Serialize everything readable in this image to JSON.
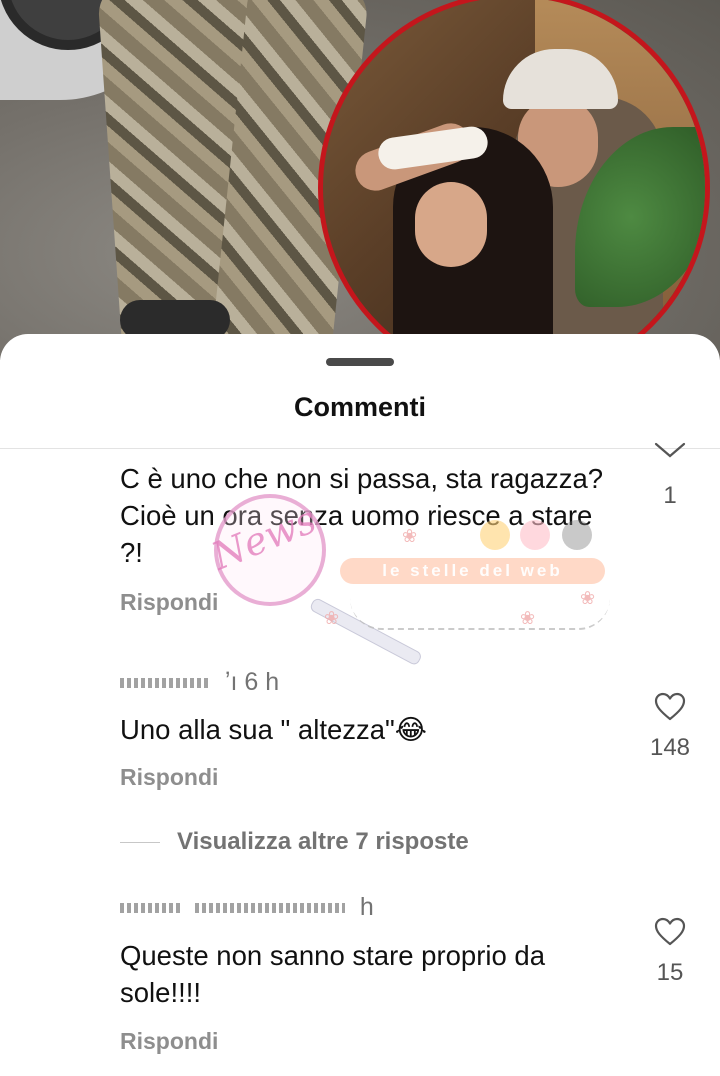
{
  "sheet": {
    "title": "Commenti"
  },
  "comments": [
    {
      "author": "",
      "time": "",
      "text": "C è uno che non si passa, sta ragazza? Cioè un ora senza uomo riesce a stare ?!",
      "reply_label": "Rispondi",
      "likes": "1"
    },
    {
      "author": "ʼı",
      "time": "6 h",
      "text": "Uno alla sua \" altezza\"😂",
      "reply_label": "Rispondi",
      "likes": "148"
    },
    {
      "author": "",
      "time": "h",
      "text": "Queste non sanno stare proprio da sole!!!!",
      "reply_label": "Rispondi",
      "likes": "15"
    }
  ],
  "view_more_replies": "Visualizza altre 7 risposte",
  "watermark": {
    "script": "News",
    "banner": "le stelle del web"
  },
  "colors": {
    "inset_border": "#c4161c",
    "meta_text": "#737373",
    "reply_text": "#8e8e8e"
  },
  "icons": [
    "heart-outline-icon",
    "chevron-down-icon"
  ]
}
